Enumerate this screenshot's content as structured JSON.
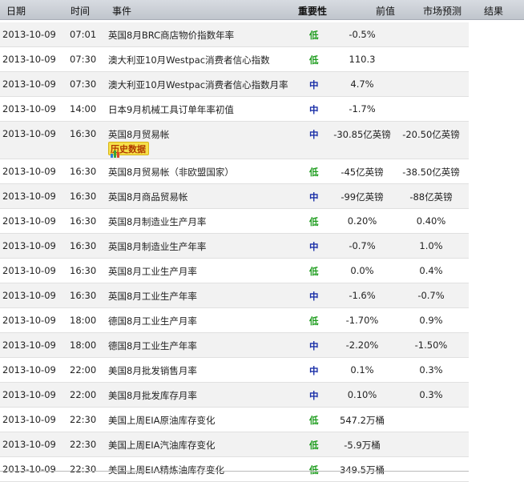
{
  "header": {
    "date": "日期",
    "time": "时间",
    "event": "事件",
    "importance": "重要性",
    "previous": "前值",
    "forecast": "市场预测",
    "result": "结果"
  },
  "history_label": "历史数据",
  "rows": [
    {
      "date": "2013-10-09",
      "time": "07:01",
      "event": "英国8月BRC商店物价指数年率",
      "importance": "低",
      "level": "low",
      "previous": "-0.5%",
      "forecast": ""
    },
    {
      "date": "2013-10-09",
      "time": "07:30",
      "event": "澳大利亚10月Westpac消费者信心指数",
      "importance": "低",
      "level": "low",
      "previous": "110.3",
      "forecast": ""
    },
    {
      "date": "2013-10-09",
      "time": "07:30",
      "event": "澳大利亚10月Westpac消费者信心指数月率",
      "importance": "中",
      "level": "mid",
      "previous": "4.7%",
      "forecast": ""
    },
    {
      "date": "2013-10-09",
      "time": "14:00",
      "event": "日本9月机械工具订单年率初值",
      "importance": "中",
      "level": "mid",
      "previous": "-1.7%",
      "forecast": ""
    },
    {
      "date": "2013-10-09",
      "time": "16:30",
      "event": "英国8月贸易帐",
      "importance": "中",
      "level": "mid",
      "previous": "-30.85亿英镑",
      "forecast": "-20.50亿英镑",
      "history": true
    },
    {
      "date": "2013-10-09",
      "time": "16:30",
      "event": "英国8月贸易帐（非欧盟国家）",
      "importance": "低",
      "level": "low",
      "previous": "-45亿英镑",
      "forecast": "-38.50亿英镑"
    },
    {
      "date": "2013-10-09",
      "time": "16:30",
      "event": "英国8月商品贸易帐",
      "importance": "中",
      "level": "mid",
      "previous": "-99亿英镑",
      "forecast": "-88亿英镑"
    },
    {
      "date": "2013-10-09",
      "time": "16:30",
      "event": "英国8月制造业生产月率",
      "importance": "低",
      "level": "low",
      "previous": "0.20%",
      "forecast": "0.40%"
    },
    {
      "date": "2013-10-09",
      "time": "16:30",
      "event": "英国8月制造业生产年率",
      "importance": "中",
      "level": "mid",
      "previous": "-0.7%",
      "forecast": "1.0%"
    },
    {
      "date": "2013-10-09",
      "time": "16:30",
      "event": "英国8月工业生产月率",
      "importance": "低",
      "level": "low",
      "previous": "0.0%",
      "forecast": "0.4%"
    },
    {
      "date": "2013-10-09",
      "time": "16:30",
      "event": "英国8月工业生产年率",
      "importance": "中",
      "level": "mid",
      "previous": "-1.6%",
      "forecast": "-0.7%"
    },
    {
      "date": "2013-10-09",
      "time": "18:00",
      "event": "德国8月工业生产月率",
      "importance": "低",
      "level": "low",
      "previous": "-1.70%",
      "forecast": "0.9%"
    },
    {
      "date": "2013-10-09",
      "time": "18:00",
      "event": "德国8月工业生产年率",
      "importance": "中",
      "level": "mid",
      "previous": "-2.20%",
      "forecast": "-1.50%"
    },
    {
      "date": "2013-10-09",
      "time": "22:00",
      "event": "美国8月批发销售月率",
      "importance": "中",
      "level": "mid",
      "previous": "0.1%",
      "forecast": "0.3%"
    },
    {
      "date": "2013-10-09",
      "time": "22:00",
      "event": "美国8月批发库存月率",
      "importance": "中",
      "level": "mid",
      "previous": "0.10%",
      "forecast": "0.3%"
    },
    {
      "date": "2013-10-09",
      "time": "22:30",
      "event": "美国上周EIA原油库存变化",
      "importance": "低",
      "level": "low",
      "previous": "547.2万桶",
      "forecast": ""
    },
    {
      "date": "2013-10-09",
      "time": "22:30",
      "event": "美国上周EIA汽油库存变化",
      "importance": "低",
      "level": "low",
      "previous": "-5.9万桶",
      "forecast": ""
    },
    {
      "date": "2013-10-09",
      "time": "22:30",
      "event": "美国上周EIA精炼油库存变化",
      "importance": "低",
      "level": "low",
      "previous": "349.5万桶",
      "forecast": ""
    }
  ]
}
